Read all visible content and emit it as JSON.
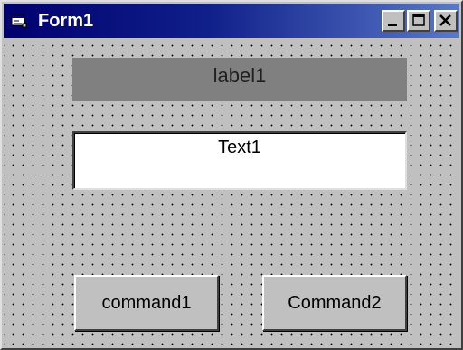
{
  "window": {
    "title": "Form1",
    "icon": "form-icon",
    "titlebar_gradient_start": "#00006e",
    "titlebar_gradient_end": "#5a78c8",
    "face_color": "#c0c0c0"
  },
  "titlebar_buttons": {
    "minimize_icon": "minimize-icon",
    "maximize_icon": "maximize-icon",
    "close_icon": "close-icon"
  },
  "form": {
    "label1": {
      "text": "label1",
      "background": "#808080"
    },
    "text1": {
      "value": "Text1"
    },
    "command1": {
      "label": "command1"
    },
    "command2": {
      "label": "Command2"
    }
  }
}
